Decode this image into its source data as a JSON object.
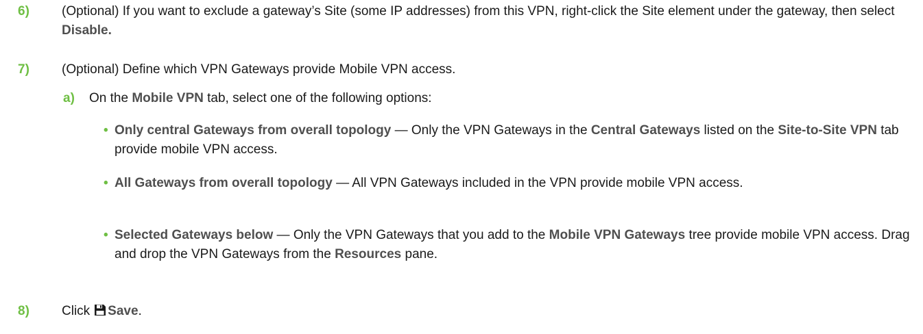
{
  "steps": [
    {
      "number": "6)",
      "pre": "(Optional) If you want to exclude a gateway’s Site (some IP addresses) from this VPN, right-click the Site element under the gateway, then select ",
      "term": "Disable."
    },
    {
      "number": "7)",
      "text": "(Optional) Define which VPN Gateways provide Mobile VPN access."
    },
    {
      "number": "8)",
      "pre": "Click",
      "icon": "save-icon",
      "term": "Save",
      "post": "."
    }
  ],
  "substep": {
    "letter": "a)",
    "pre": "On the ",
    "term": "Mobile VPN",
    "post": " tab, select one of the following options:"
  },
  "bullets": [
    {
      "option": "Only central Gateways from overall topology",
      "sep": " — Only the VPN Gateways in the ",
      "term1": "Central Gateways",
      "mid": " listed on the ",
      "term2": "Site-to-Site VPN",
      "post": " tab provide mobile VPN access."
    },
    {
      "option": "All Gateways from overall topology",
      "sep": " — All VPN Gateways included in the VPN provide mobile VPN access."
    },
    {
      "option": "Selected Gateways below",
      "sep": " — Only the VPN Gateways that you add to the ",
      "term1": "Mobile VPN Gateways",
      "mid": " tree provide mobile VPN access. Drag and drop the VPN Gateways from the ",
      "term2": "Resources",
      "post": " pane."
    }
  ],
  "bullet_symbol": "•",
  "colors": {
    "accent": "#6fbf44",
    "ui_term": "#4f4f4f",
    "text": "#1a1a1a"
  }
}
